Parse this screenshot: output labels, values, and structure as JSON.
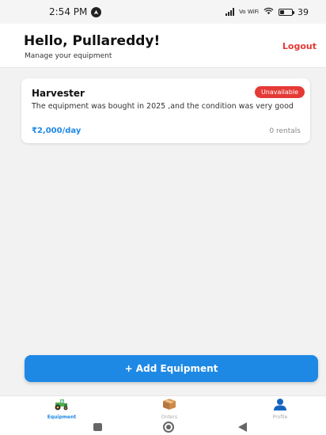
{
  "status_bar": {
    "time": "2:54 PM",
    "network": "Vo WiFi",
    "battery": "39"
  },
  "header": {
    "greeting": "Hello, Pullareddy!",
    "subtitle": "Manage your equipment",
    "logout_label": "Logout"
  },
  "equipment": [
    {
      "name": "Harvester",
      "status": "Unavailable",
      "description": "The equipment was bought in 2025 ,and the condition was very good",
      "price": "₹2,000/day",
      "rentals": "0 rentals"
    }
  ],
  "add_button_label": "+ Add Equipment",
  "bottom_nav": [
    {
      "label": "Equipment",
      "icon": "tractor-icon",
      "active": true
    },
    {
      "label": "Orders",
      "icon": "box-icon",
      "active": false
    },
    {
      "label": "Profile",
      "icon": "person-icon",
      "active": false
    }
  ],
  "colors": {
    "accent": "#1e88e5",
    "danger": "#e53935"
  }
}
